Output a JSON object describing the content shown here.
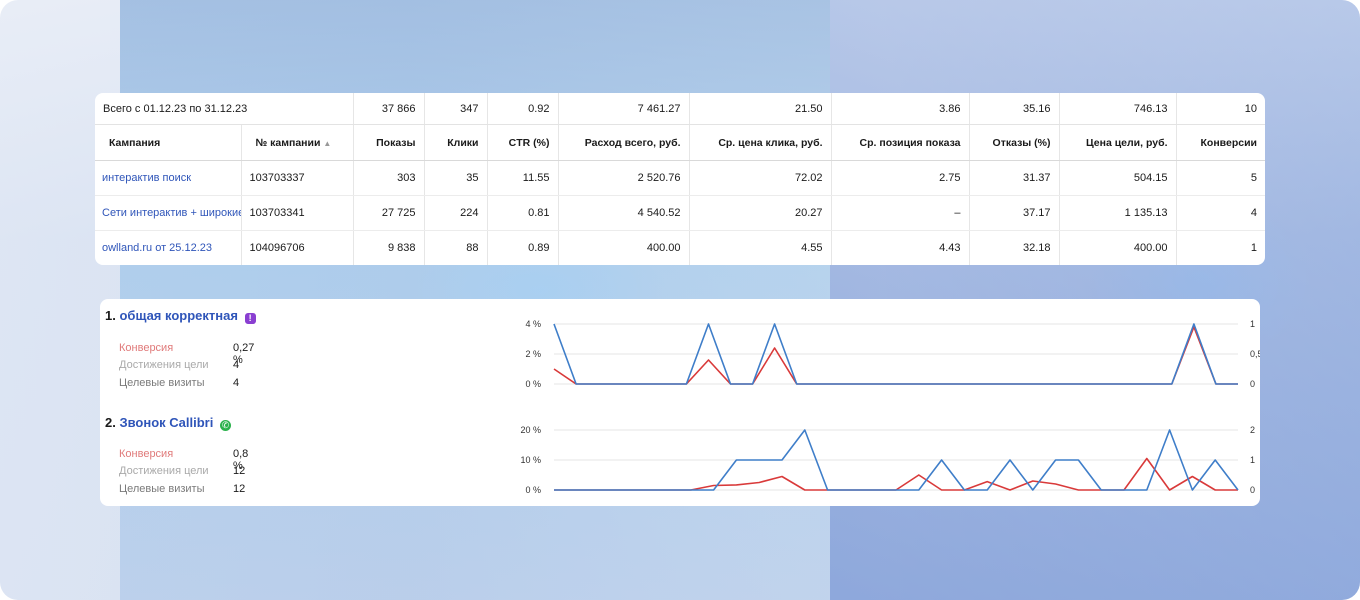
{
  "table": {
    "total": {
      "label": "Всего с 01.12.23 по 31.12.23",
      "shows": "37 866",
      "clicks": "347",
      "ctr": "0.92",
      "cost": "7 461.27",
      "cpc": "21.50",
      "position": "3.86",
      "bounce": "35.16",
      "goal_price": "746.13",
      "conversions": "10"
    },
    "columns": [
      "Кампания",
      "№ кампании",
      "Показы",
      "Клики",
      "CTR (%)",
      "Расход всего, руб.",
      "Ср. цена клика, руб.",
      "Ср. позиция показа",
      "Отказы (%)",
      "Цена цели, руб.",
      "Конверсии"
    ],
    "sort_indicator": "▲",
    "rows": [
      {
        "name": "интерактив поиск",
        "id": "103703337",
        "shows": "303",
        "clicks": "35",
        "ctr": "11.55",
        "cost": "2 520.76",
        "cpc": "72.02",
        "position": "2.75",
        "bounce": "31.37",
        "goal_price": "504.15",
        "conversions": "5"
      },
      {
        "name": "Сети интерактив + широкие",
        "id": "103703341",
        "shows": "27 725",
        "clicks": "224",
        "ctr": "0.81",
        "cost": "4 540.52",
        "cpc": "20.27",
        "position": "–",
        "bounce": "37.17",
        "goal_price": "1 135.13",
        "conversions": "4"
      },
      {
        "name": "owlland.ru от 25.12.23",
        "id": "104096706",
        "shows": "9 838",
        "clicks": "88",
        "ctr": "0.89",
        "cost": "400.00",
        "cpc": "4.55",
        "position": "4.43",
        "bounce": "32.18",
        "goal_price": "400.00",
        "conversions": "1"
      }
    ]
  },
  "goals": [
    {
      "index": "1.",
      "title": "общая корректная",
      "badge_icon": "metrica-icon",
      "badge_glyph": "!",
      "metrics": {
        "conversion_label": "Конверсия",
        "conversion_value": "0,27 %",
        "reaches_label": "Достижения цели",
        "reaches_value": "4",
        "visits_label": "Целевые визиты",
        "visits_value": "4"
      },
      "chart": {
        "left_ticks": [
          "4 %",
          "2 %",
          "0 %"
        ],
        "right_ticks": [
          "1",
          "0,5",
          "0"
        ],
        "left_max": 4,
        "right_max": 1,
        "blue": [
          4,
          0,
          0,
          0,
          0,
          0,
          0,
          4,
          0,
          0,
          4,
          0,
          0,
          0,
          0,
          0,
          0,
          0,
          0,
          0,
          0,
          0,
          0,
          0,
          0,
          0,
          0,
          0,
          0,
          4,
          0,
          0
        ],
        "red": [
          1,
          0,
          0,
          0,
          0,
          0,
          0,
          1.6,
          0,
          0,
          2.4,
          0,
          0,
          0,
          0,
          0,
          0,
          0,
          0,
          0,
          0,
          0,
          0,
          0,
          0,
          0,
          0,
          0,
          0,
          3.8,
          0,
          0
        ]
      }
    },
    {
      "index": "2.",
      "title": "Звонок Callibri",
      "badge_icon": "whatsapp-icon",
      "badge_glyph": "✆",
      "metrics": {
        "conversion_label": "Конверсия",
        "conversion_value": "0,8 %",
        "reaches_label": "Достижения цели",
        "reaches_value": "12",
        "visits_label": "Целевые визиты",
        "visits_value": "12"
      },
      "chart": {
        "left_ticks": [
          "20 %",
          "10 %",
          "0 %"
        ],
        "right_ticks": [
          "2",
          "1",
          "0"
        ],
        "left_max": 20,
        "right_max": 2,
        "blue": [
          0,
          0,
          0,
          0,
          0,
          0,
          0,
          0,
          10,
          10,
          10,
          20,
          0,
          0,
          0,
          0,
          0,
          10,
          0,
          0,
          10,
          0,
          10,
          10,
          0,
          0,
          0,
          20,
          0,
          10,
          0
        ],
        "red": [
          0,
          0,
          0,
          0,
          0,
          0,
          0,
          1.5,
          1.7,
          2.5,
          4.5,
          0,
          0,
          0,
          0,
          0,
          5,
          0,
          0,
          2.8,
          0,
          3,
          2,
          0,
          0,
          0,
          10.5,
          0,
          4.5,
          0,
          0
        ]
      }
    }
  ],
  "colors": {
    "blue_series": "#3f7ec9",
    "red_series": "#d93a3a",
    "link": "#2f55b9",
    "grid": "#e6e6e6"
  }
}
